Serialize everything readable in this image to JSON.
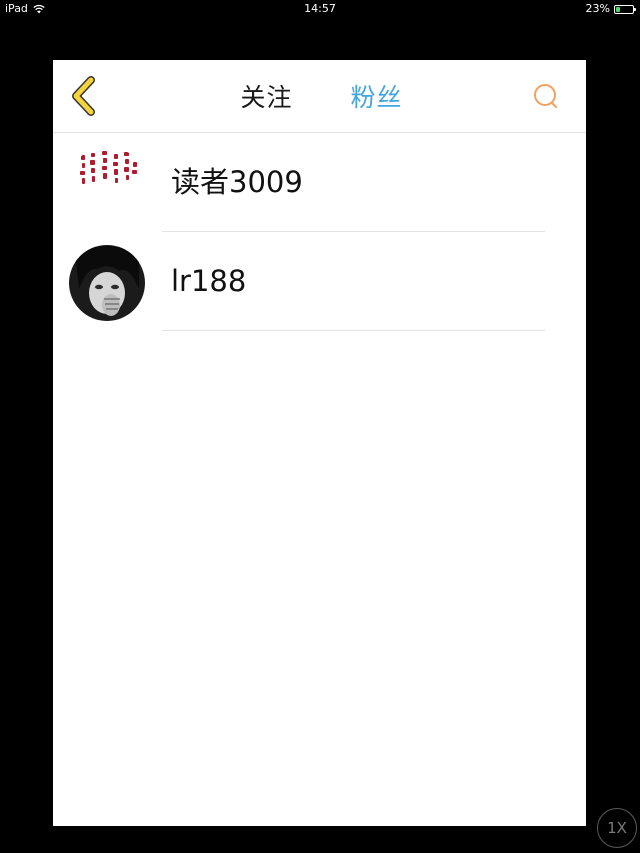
{
  "status_bar": {
    "device": "iPad",
    "time": "14:57",
    "battery": "23%",
    "battery_level": 0.23,
    "wifi_icon": "wifi-icon",
    "battery_icon": "battery-icon"
  },
  "nav": {
    "back_icon": "chevron-left-icon",
    "tabs": [
      {
        "label": "关注",
        "active": false
      },
      {
        "label": "粉丝",
        "active": true
      }
    ],
    "search_icon": "search-icon",
    "colors": {
      "active_tab": "#44a6e0",
      "back_icon": "#f5d33b",
      "search_icon": "#f2a15f"
    }
  },
  "list": {
    "items": [
      {
        "name": "读者3009",
        "avatar": "calligraphy-avatar"
      },
      {
        "name": "lr188",
        "avatar": "portrait-avatar"
      }
    ]
  },
  "zoom_button": {
    "label": "1X"
  }
}
